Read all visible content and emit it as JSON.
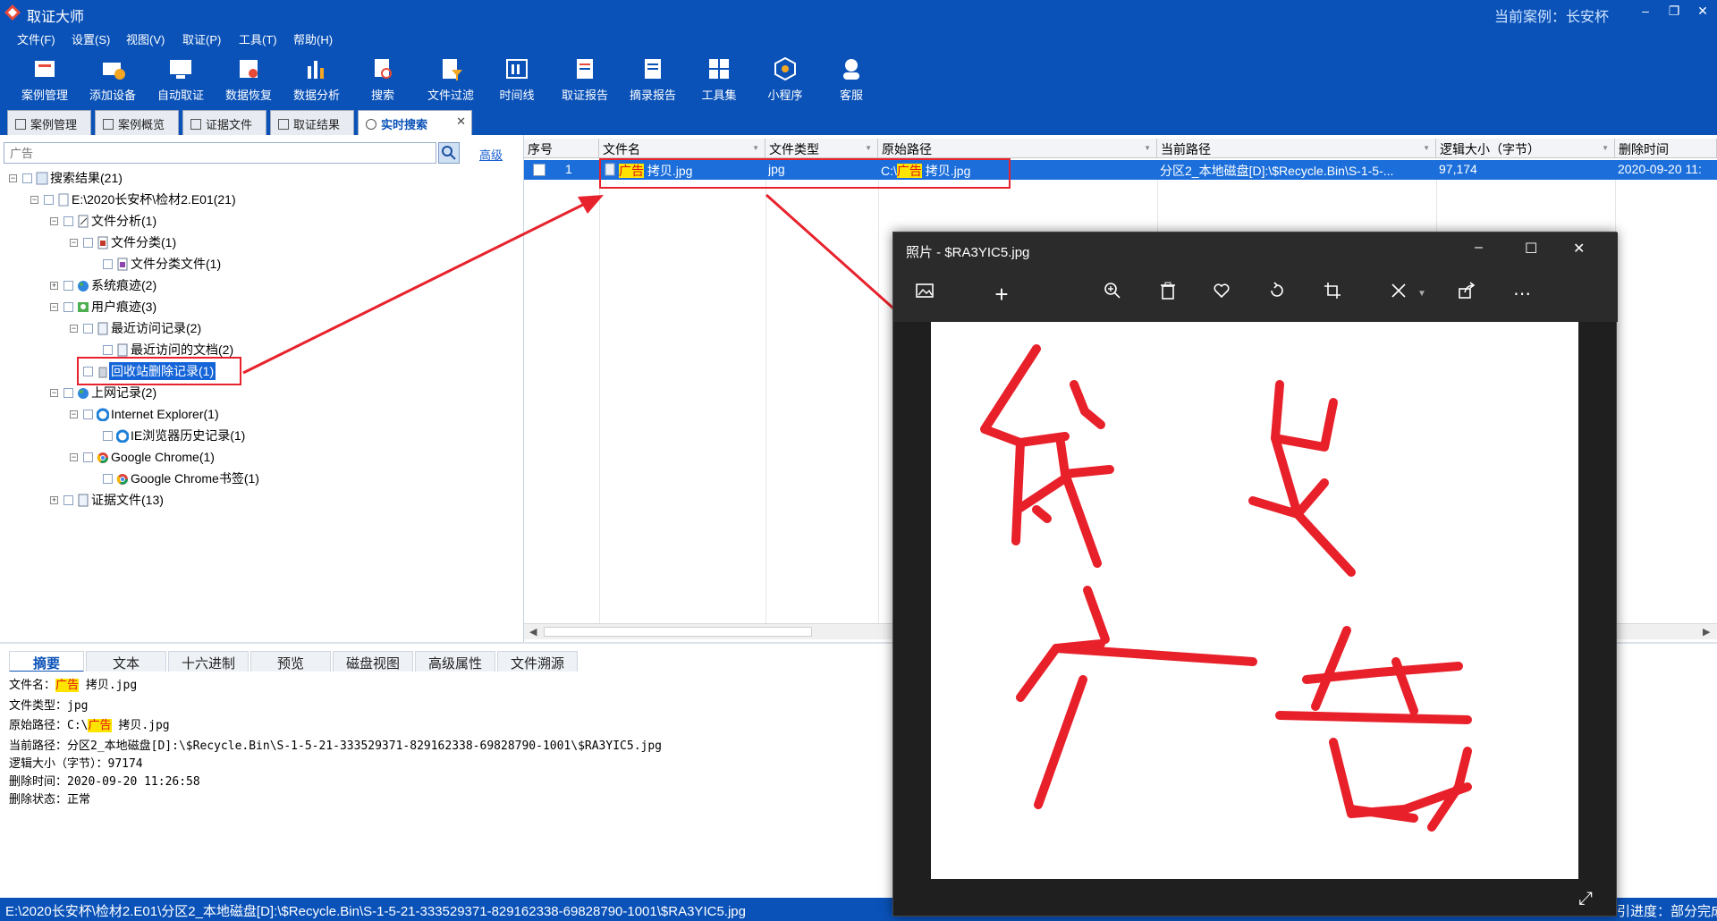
{
  "title": {
    "app": "取证大师",
    "current_case": "当前案例：长安杯"
  },
  "menu": [
    "文件(F)",
    "设置(S)",
    "视图(V)",
    "取证(P)",
    "工具(T)",
    "帮助(H)"
  ],
  "toolbar": [
    "案例管理",
    "添加设备",
    "自动取证",
    "数据恢复",
    "数据分析",
    "搜索",
    "文件过滤",
    "时间线",
    "取证报告",
    "摘录报告",
    "工具集",
    "小程序",
    "客服"
  ],
  "tabs": [
    "案例管理",
    "案例概览",
    "证据文件",
    "取证结果",
    "实时搜索"
  ],
  "search": {
    "placeholder": "广告",
    "advanced": "高级"
  },
  "tree": [
    {
      "label": "搜索结果(21)"
    },
    {
      "label": "E:\\2020长安杯\\检材2.E01(21)"
    },
    {
      "label": "文件分析(1)"
    },
    {
      "label": "文件分类(1)"
    },
    {
      "label": "文件分类文件(1)"
    },
    {
      "label": "系统痕迹(2)"
    },
    {
      "label": "用户痕迹(3)"
    },
    {
      "label": "最近访问记录(2)"
    },
    {
      "label": "最近访问的文档(2)"
    },
    {
      "label": "回收站删除记录(1)"
    },
    {
      "label": "上网记录(2)"
    },
    {
      "label": "Internet Explorer(1)"
    },
    {
      "label": "IE浏览器历史记录(1)"
    },
    {
      "label": "Google Chrome(1)"
    },
    {
      "label": "Google Chrome书签(1)"
    },
    {
      "label": "证据文件(13)"
    }
  ],
  "grid": {
    "headers": [
      "序号",
      "文件名",
      "文件类型",
      "原始路径",
      "当前路径",
      "逻辑大小（字节）",
      "删除时间"
    ],
    "row": {
      "index": "1",
      "name_mark": "广告",
      "name_rest": " 拷贝.jpg",
      "type": "jpg",
      "orig_prefix": "C:\\",
      "orig_mark": "广告",
      "orig_rest": " 拷贝.jpg",
      "current_path": "分区2_本地磁盘[D]:\\$Recycle.Bin\\S-1-5-...",
      "size": "97,174",
      "deleted": "2020-09-20 11:"
    }
  },
  "bottom_tabs": [
    "摘要",
    "文本",
    "十六进制",
    "预览",
    "磁盘视图",
    "高级属性",
    "文件溯源"
  ],
  "detail": {
    "name_label": "文件名：",
    "name_mark": "广告",
    "name_rest": " 拷贝.jpg",
    "type": "文件类型：jpg",
    "orig_label": "原始路径：C:\\",
    "orig_mark": "广告",
    "orig_rest": " 拷贝.jpg",
    "current": "当前路径：分区2_本地磁盘[D]:\\$Recycle.Bin\\S-1-5-21-333529371-829162338-69828790-1001\\$RA3YIC5.jpg",
    "size": "逻辑大小（字节）：97174",
    "deleted": "删除时间：2020-09-20 11:26:58",
    "state": "删除状态：正常"
  },
  "status": {
    "path": "E:\\2020长安杯\\检材2.E01\\分区2_本地磁盘[D]:\\$Recycle.Bin\\S-1-5-21-333529371-829162338-69828790-1001\\$RA3YIC5.jpg",
    "progress": "引进度：部分完成"
  },
  "viewer": {
    "title": "照片 - $RA3YIC5.jpg"
  },
  "colors": {
    "brand": "#0a52b8",
    "highlight": "#ffe400",
    "annotation": "#e8222c",
    "selection": "#1c6fdb"
  }
}
